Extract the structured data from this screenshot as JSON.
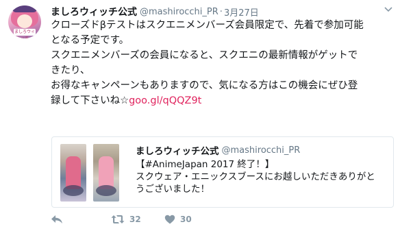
{
  "tweet": {
    "display_name": "ましろウィッチ公式",
    "handle": "@mashirocchi_PR",
    "separator": "·",
    "date": "3月27日",
    "avatar_text": "ましろウィッチ",
    "text_lines": [
      "クローズドβテストはスクエニメンバーズ会員限定で、先着で参加可能",
      "となる予定です。",
      "スクエニメンバーズの会員になると、スクエニの最新情報がゲットで",
      "きたり、",
      "お得なキャンペーンもありますので、気になる方はこの機会にぜひ登",
      "録して下さいね☆"
    ],
    "link": "goo.gl/qQQZ9t",
    "caret_icon": "chevron-down-icon"
  },
  "quote": {
    "display_name": "ましろウィッチ公式",
    "handle": "@mashirocchi_PR",
    "text_lines": [
      "【#AnimeJapan 2017 終了！】",
      "スクウェア・エニックスブースにお越しいただきありがと",
      "うございました！"
    ]
  },
  "actions": {
    "reply_icon": "reply-icon",
    "retweet_icon": "retweet-icon",
    "retweet_count": "32",
    "like_icon": "heart-icon",
    "like_count": "30"
  },
  "colors": {
    "link": "#e0245e",
    "muted": "#657786",
    "icon": "#8899a6",
    "border": "#e1e8ed",
    "text": "#14171a"
  }
}
